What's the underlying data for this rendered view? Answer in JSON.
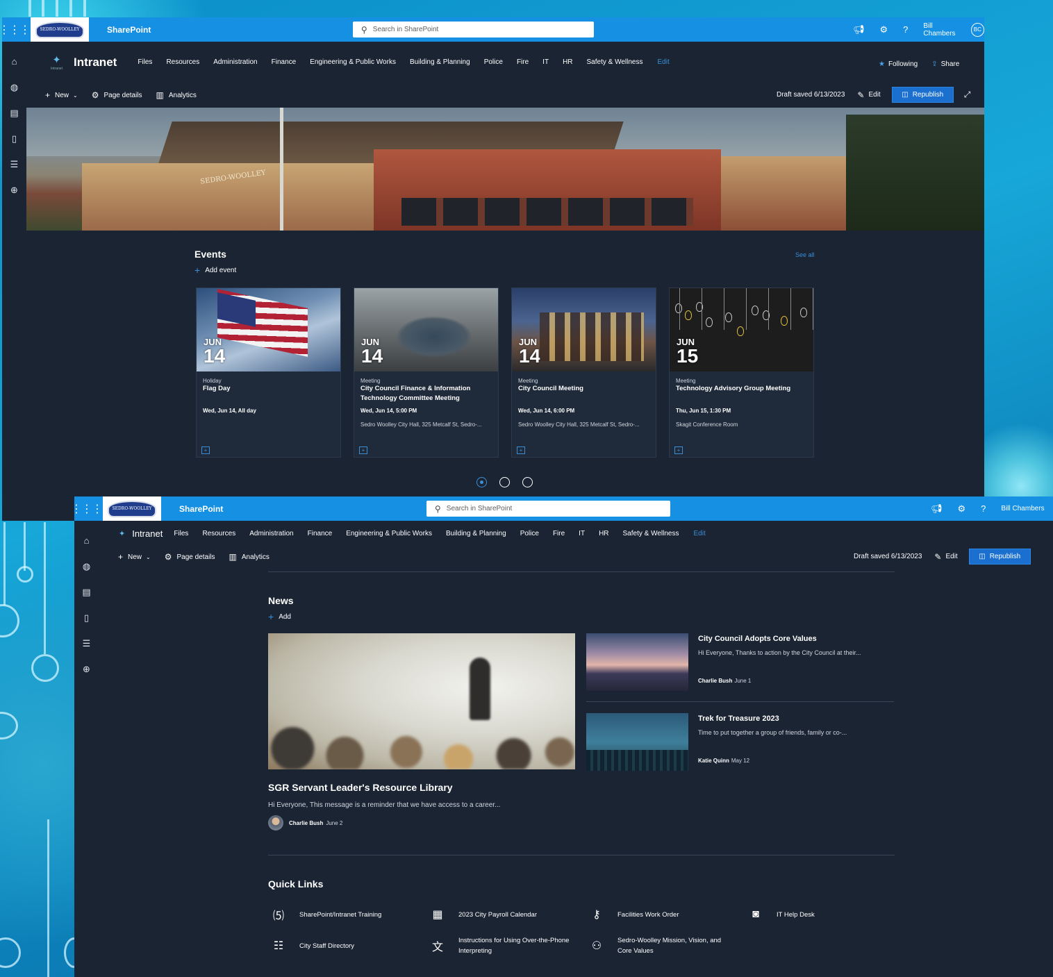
{
  "colors": {
    "suitebar": "#1690e3",
    "page_bg": "#1b2433",
    "accent": "#3a8fd6"
  },
  "suitebar": {
    "app_name": "SharePoint",
    "logo_text": "SEDRO-WOOLLEY",
    "search_placeholder": "Search in SharePoint",
    "user_name": "Bill Chambers",
    "user_initials": "BC",
    "icons": [
      "megaphone-icon",
      "gear-icon",
      "help-icon"
    ]
  },
  "hub_nav": {
    "site_title": "Intranet",
    "site_icon_caption": "Intranet",
    "items": [
      "Files",
      "Resources",
      "Administration",
      "Finance",
      "Engineering & Public Works",
      "Building & Planning",
      "Police",
      "Fire",
      "IT",
      "HR",
      "Safety & Wellness"
    ],
    "edit_label": "Edit",
    "following_label": "Following",
    "share_label": "Share"
  },
  "command_bar": {
    "new_label": "New",
    "page_details_label": "Page details",
    "analytics_label": "Analytics",
    "draft_status": "Draft saved 6/13/2023",
    "edit_label": "Edit",
    "republish_label": "Republish"
  },
  "hero": {
    "building_sign": "SEDRO-WOOLLEY"
  },
  "events": {
    "title": "Events",
    "add_label": "Add event",
    "see_all": "See all",
    "items": [
      {
        "month": "JUN",
        "day": "14",
        "category": "Holiday",
        "title": "Flag Day",
        "time": "Wed, Jun 14, All day",
        "location": ""
      },
      {
        "month": "JUN",
        "day": "14",
        "category": "Meeting",
        "title": "City Council Finance & Information Technology Committee Meeting",
        "time": "Wed, Jun 14, 5:00 PM",
        "location": "Sedro Woolley City Hall, 325 Metcalf St, Sedro-..."
      },
      {
        "month": "JUN",
        "day": "14",
        "category": "Meeting",
        "title": "City Council Meeting",
        "time": "Wed, Jun 14, 6:00 PM",
        "location": "Sedro Woolley City Hall, 325 Metcalf St, Sedro-..."
      },
      {
        "month": "JUN",
        "day": "15",
        "category": "Meeting",
        "title": "Technology Advisory Group Meeting",
        "time": "Thu, Jun 15, 1:30 PM",
        "location": "Skagit Conference Room"
      }
    ],
    "pager_pages": 3,
    "pager_active": 1
  },
  "news": {
    "title": "News",
    "add_label": "Add",
    "featured": {
      "title": "SGR Servant Leader's Resource Library",
      "description": "Hi Everyone, This message is a reminder that we have access to a career...",
      "author": "Charlie Bush",
      "date": "June 2"
    },
    "items": [
      {
        "title": "City Council Adopts Core Values",
        "description": "Hi Everyone, Thanks to action by the City Council at their...",
        "author": "Charlie Bush",
        "date": "June 1"
      },
      {
        "title": "Trek for Treasure 2023",
        "description": "Time to put together a group of friends, family or co-...",
        "author": "Katie Quinn",
        "date": "May 12"
      }
    ]
  },
  "quick_links": {
    "title": "Quick Links",
    "items": [
      {
        "label": "SharePoint/Intranet Training",
        "icon": "sharepoint-icon"
      },
      {
        "label": "2023 City Payroll Calendar",
        "icon": "calendar-icon"
      },
      {
        "label": "Facilities Work Order",
        "icon": "person-key-icon"
      },
      {
        "label": "IT Help Desk",
        "icon": "camera-frame-icon"
      },
      {
        "label": "City Staff Directory",
        "icon": "directory-icon"
      },
      {
        "label": "Instructions for Using Over-the-Phone Interpreting",
        "icon": "translate-icon"
      },
      {
        "label": "Sedro-Woolley Mission, Vision, and Core Values",
        "icon": "people-network-icon"
      }
    ]
  }
}
